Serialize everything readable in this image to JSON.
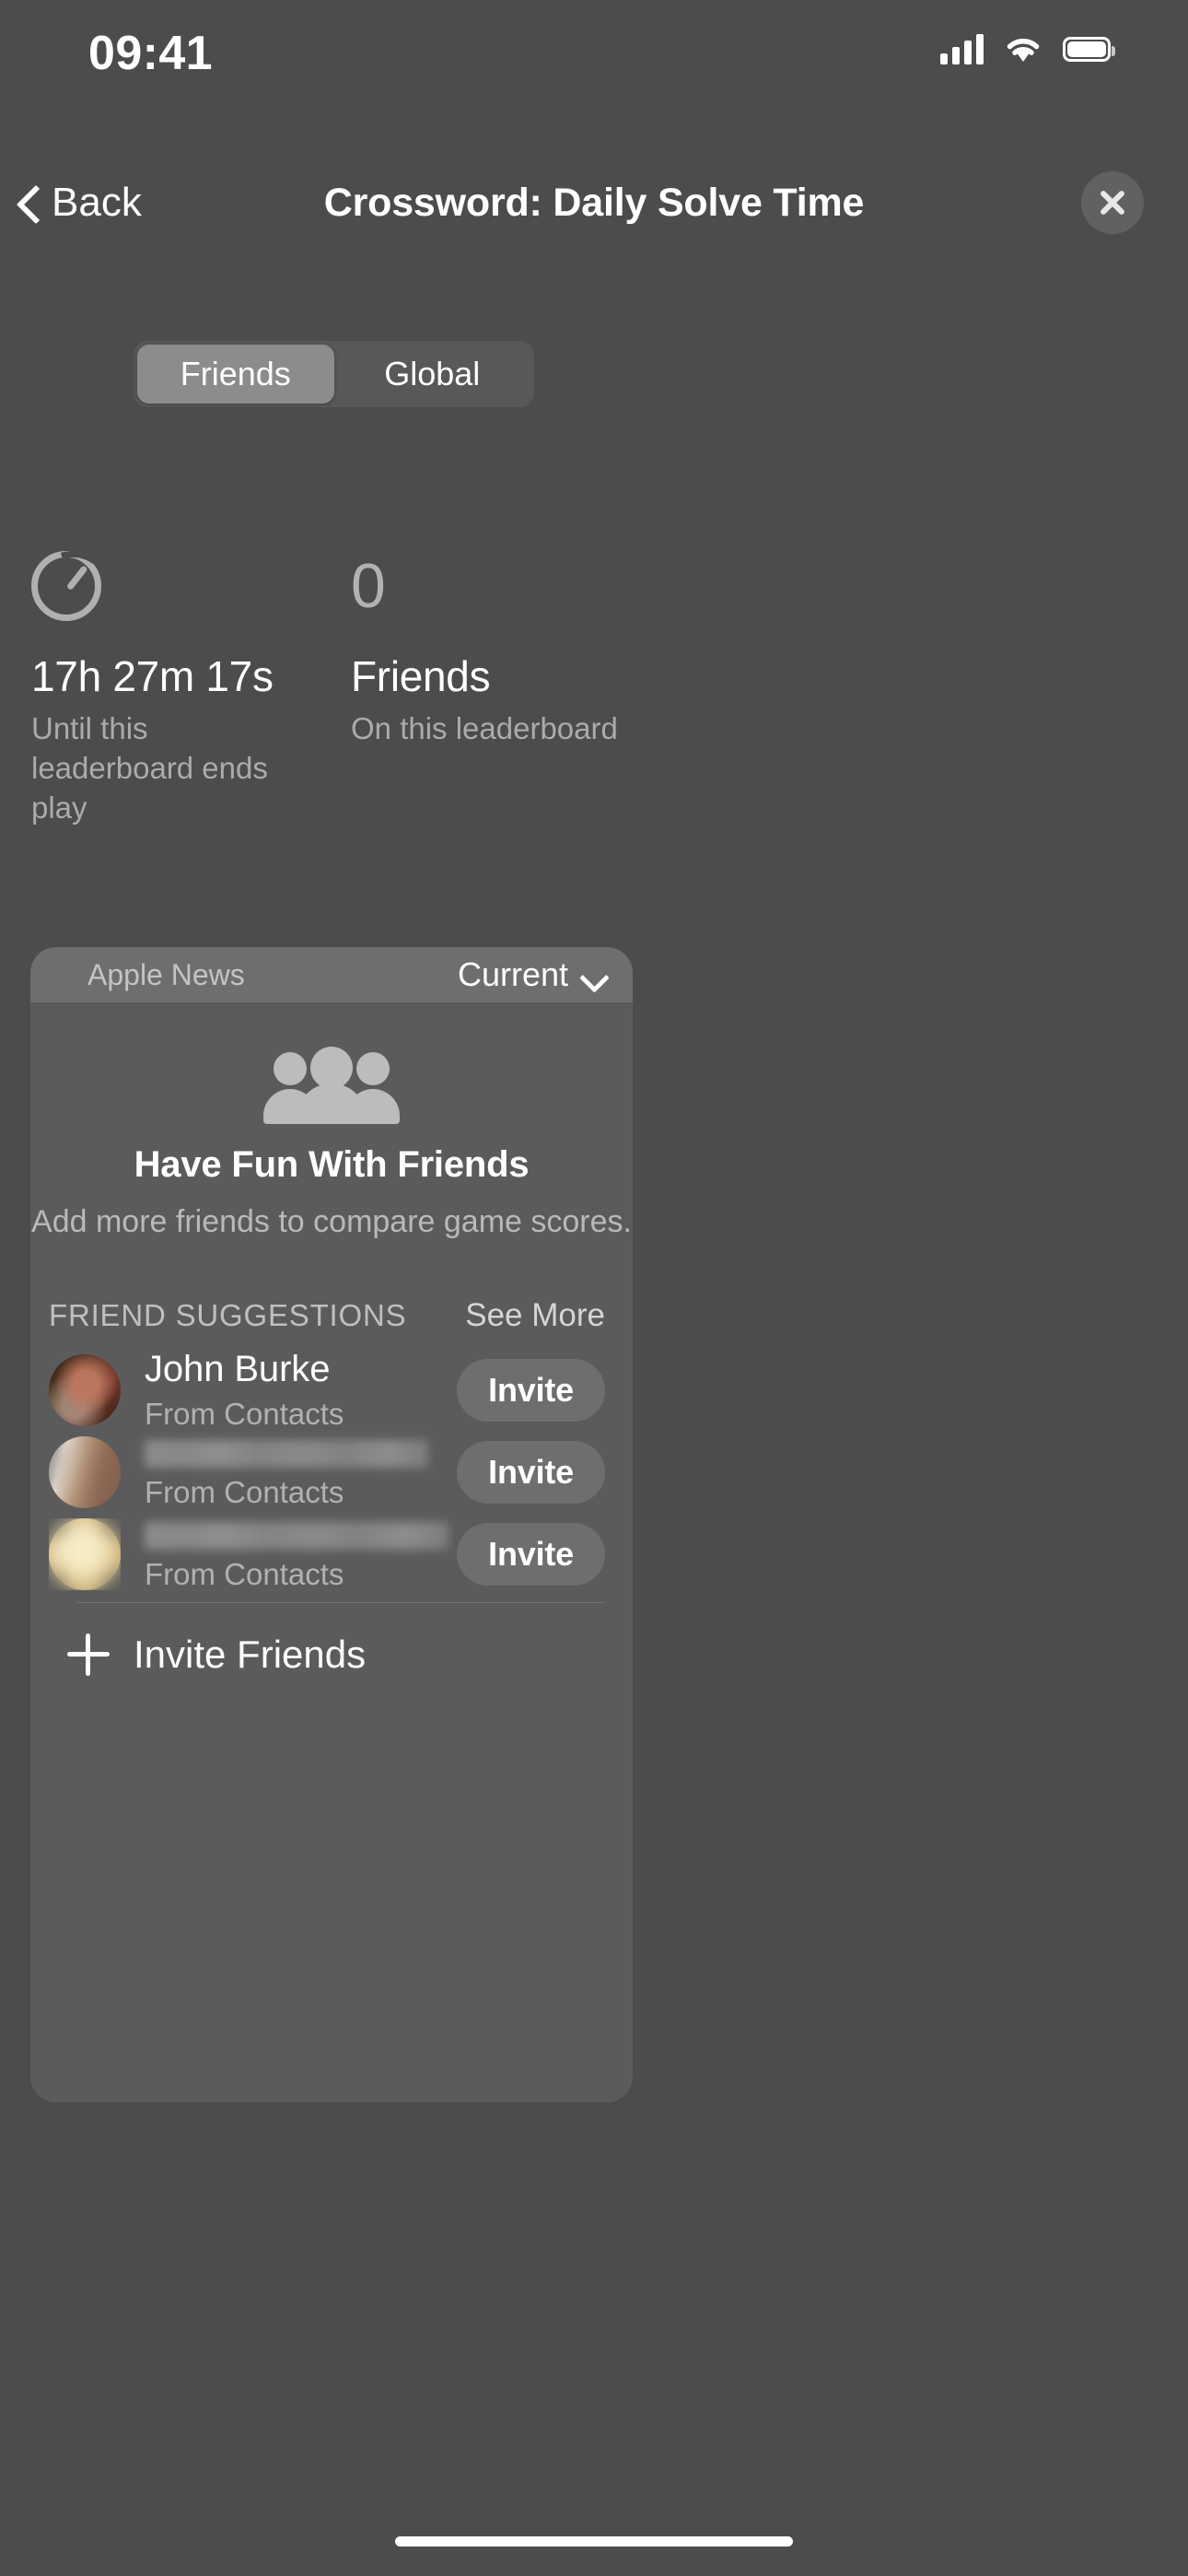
{
  "status_bar": {
    "time": "09:41",
    "cellular_icon": "signal-bars-icon",
    "wifi_icon": "wifi-icon",
    "battery_icon": "battery-icon"
  },
  "nav": {
    "back_label": "Back",
    "back_icon": "chevron-left-icon",
    "title": "Crossword: Daily Solve Time",
    "close_icon": "close-icon"
  },
  "segmented_control": {
    "options": [
      {
        "label": "Friends",
        "selected": true
      },
      {
        "label": "Global",
        "selected": false
      }
    ]
  },
  "stats": [
    {
      "icon": "timer-icon",
      "value": "17h 27m 17s",
      "caption": "Until this leaderboard ends play"
    },
    {
      "icon": "",
      "count": "0",
      "value": "Friends",
      "caption": "On this leaderboard"
    }
  ],
  "card": {
    "source": "Apple News",
    "filter_label": "Current",
    "filter_icon": "chevron-down-icon"
  },
  "hero": {
    "icon": "people-group-icon",
    "title": "Have Fun With Friends",
    "subtitle": "Add more friends to compare game scores."
  },
  "suggestions_section": {
    "title": "FRIEND SUGGESTIONS",
    "action_label": "See More",
    "rows": [
      {
        "name": "John Burke",
        "subtitle": "From Contacts",
        "avatar": "contact-avatar",
        "redacted": false,
        "button_label": "Invite"
      },
      {
        "name": "",
        "subtitle": "From Contacts",
        "avatar": "contact-avatar",
        "redacted": true,
        "button_label": "Invite"
      },
      {
        "name": "",
        "subtitle": "From Contacts",
        "avatar": "contact-avatar",
        "redacted": true,
        "button_label": "Invite"
      }
    ]
  },
  "footer": {
    "icon": "plus-icon",
    "label": "Invite Friends"
  },
  "colors": {
    "background": "#4c4c4c",
    "card": "#5b5b5b",
    "card_header": "#6e6e6e",
    "segment_active": "#8c8c8f",
    "text_primary": "#ffffff",
    "text_secondary": "#b1b1b1"
  }
}
